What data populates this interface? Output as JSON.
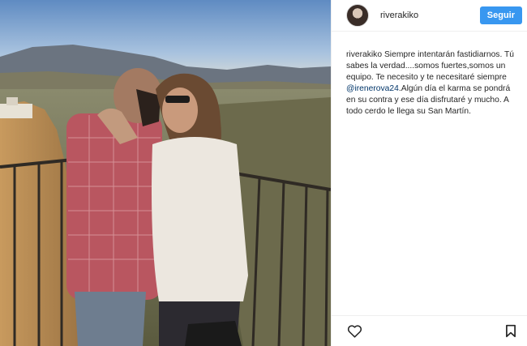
{
  "post": {
    "username": "riverakiko",
    "follow_label": "Seguir",
    "caption": {
      "user": "riverakiko",
      "text_before_mention": "Siempre intentarán fastidiarnos. Tú sabes la verdad....somos fuertes,somos un equipo. Te necesito y te necesitaré siempre",
      "mention": "@irenerova24",
      "text_after_mention": ".Algún día el karma se pondrá en su contra y ese día disfrutaré y mucho. A todo cerdo le llega su San Martín."
    }
  },
  "colors": {
    "follow_button": "#3897f0",
    "mention": "#003569",
    "text": "#262626",
    "border": "#efefef"
  },
  "icons": {
    "like": "heart-icon",
    "save": "bookmark-icon"
  }
}
